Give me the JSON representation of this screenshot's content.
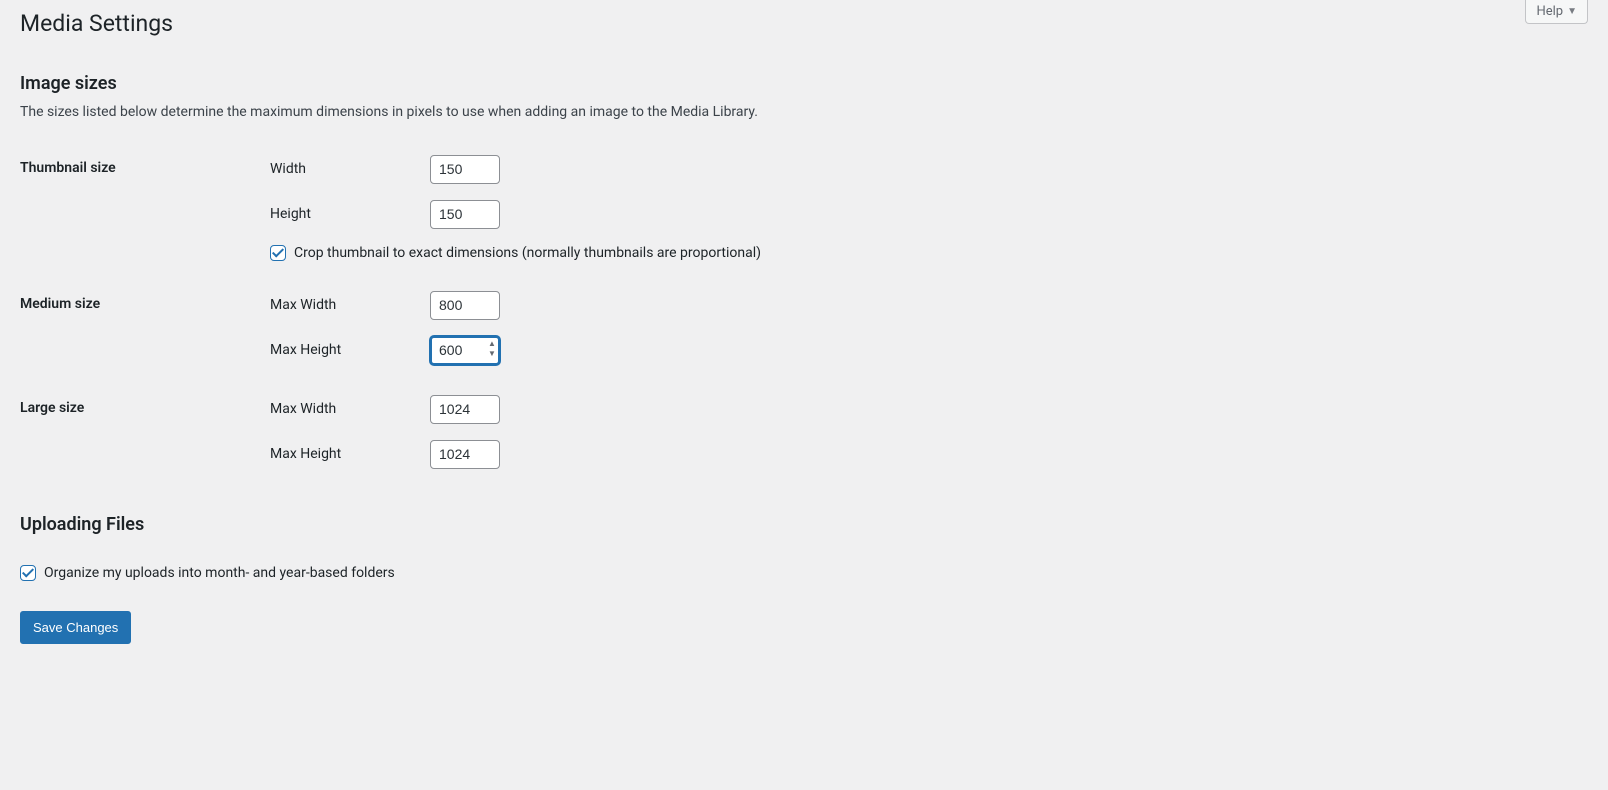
{
  "help": {
    "label": "Help"
  },
  "page": {
    "title": "Media Settings"
  },
  "imageSizes": {
    "heading": "Image sizes",
    "description": "The sizes listed below determine the maximum dimensions in pixels to use when adding an image to the Media Library.",
    "thumbnail": {
      "label": "Thumbnail size",
      "widthLabel": "Width",
      "widthValue": "150",
      "heightLabel": "Height",
      "heightValue": "150",
      "cropChecked": true,
      "cropLabel": "Crop thumbnail to exact dimensions (normally thumbnails are proportional)"
    },
    "medium": {
      "label": "Medium size",
      "maxWidthLabel": "Max Width",
      "maxWidthValue": "800",
      "maxHeightLabel": "Max Height",
      "maxHeightValue": "600"
    },
    "large": {
      "label": "Large size",
      "maxWidthLabel": "Max Width",
      "maxWidthValue": "1024",
      "maxHeightLabel": "Max Height",
      "maxHeightValue": "1024"
    }
  },
  "uploading": {
    "heading": "Uploading Files",
    "organizeChecked": true,
    "organizeLabel": "Organize my uploads into month- and year-based folders"
  },
  "submit": {
    "label": "Save Changes"
  }
}
